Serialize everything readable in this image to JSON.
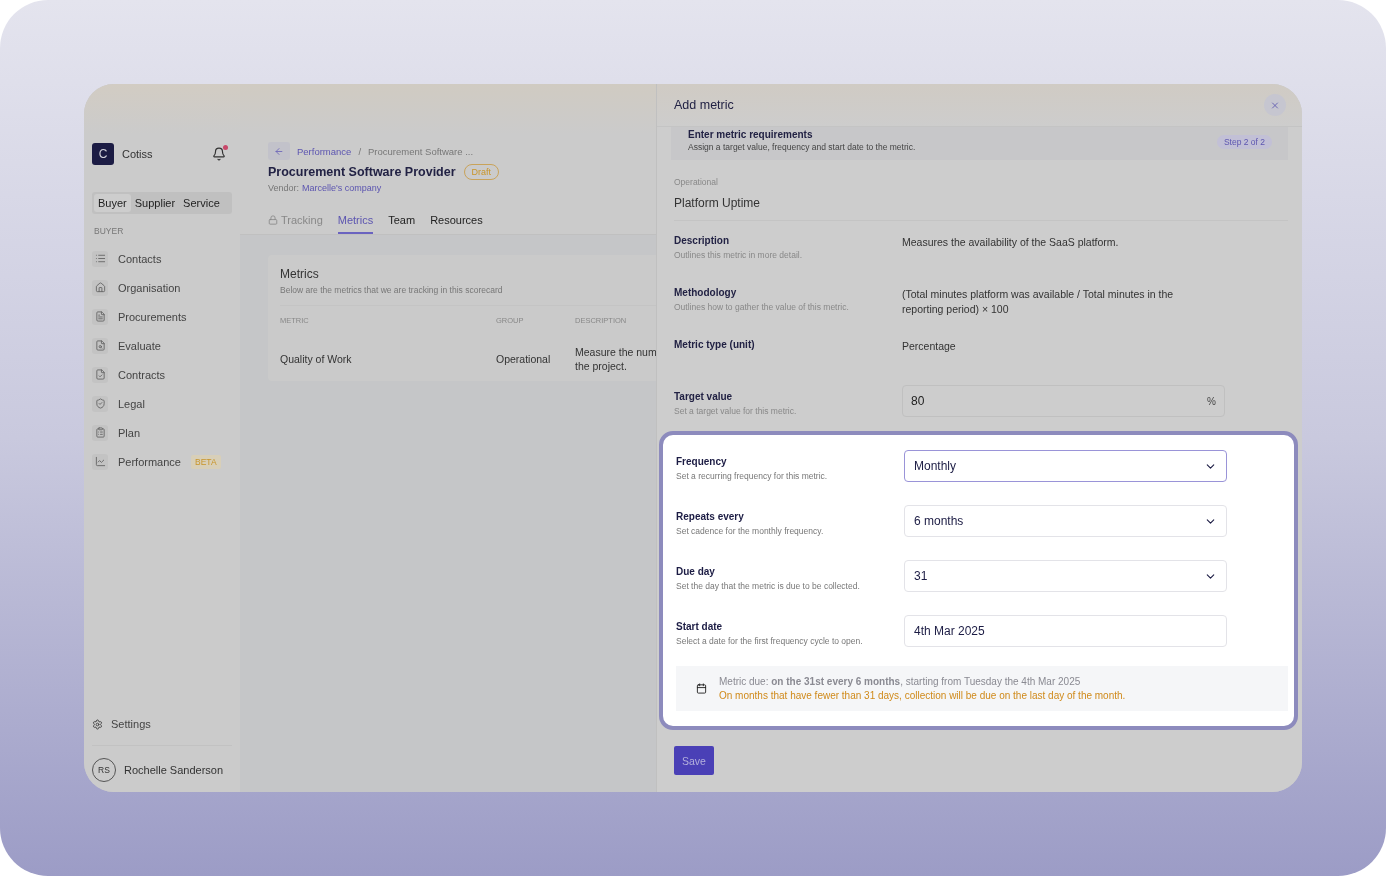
{
  "sidebar": {
    "brand": {
      "initial": "C",
      "name": "Cotiss"
    },
    "has_notification": true,
    "role_tabs": [
      {
        "label": "Buyer",
        "selected": true
      },
      {
        "label": "Supplier",
        "selected": false
      },
      {
        "label": "Service",
        "selected": false
      }
    ],
    "section": "BUYER",
    "items": [
      {
        "label": "Contacts"
      },
      {
        "label": "Organisation"
      },
      {
        "label": "Procurements"
      },
      {
        "label": "Evaluate"
      },
      {
        "label": "Contracts"
      },
      {
        "label": "Legal"
      },
      {
        "label": "Plan"
      },
      {
        "label": "Performance",
        "badge": "BETA"
      }
    ],
    "settings": "Settings",
    "user": {
      "initials": "RS",
      "name": "Rochelle Sanderson"
    }
  },
  "main": {
    "breadcrumb": [
      "Performance",
      "/",
      "Procurement Software ..."
    ],
    "title": "Procurement Software Provider",
    "status": "Draft",
    "vendor_label": "Vendor:",
    "vendor": "Marcelle's company",
    "tabs": [
      {
        "label": "Tracking",
        "selected": false,
        "locked": true
      },
      {
        "label": "Metrics",
        "selected": true,
        "locked": false
      },
      {
        "label": "Team",
        "selected": false,
        "locked": false
      },
      {
        "label": "Resources",
        "selected": false,
        "locked": false
      }
    ],
    "card": {
      "title": "Metrics",
      "subtitle": "Below are the metrics that we are tracking in this scorecard",
      "columns": [
        "METRIC",
        "GROUP",
        "DESCRIPTION"
      ],
      "rows": [
        [
          "Quality of Work",
          "Operational",
          "Measure the num\nthe project."
        ]
      ]
    }
  },
  "drawer": {
    "title": "Add metric",
    "step": {
      "title": "Enter metric requirements",
      "subtitle": "Assign a target value, frequency and start date to the metric.",
      "badge": "Step 2 of 2"
    },
    "group": "Operational",
    "metric": "Platform Uptime",
    "info": [
      {
        "label": "Description",
        "hint": "Outlines this metric in more detail.",
        "value": "Measures the availability of the SaaS platform."
      },
      {
        "label": "Methodology",
        "hint": "Outlines how to gather the value of this metric.",
        "value": "(Total minutes platform was available / Total minutes in the reporting period) × 100"
      },
      {
        "label": "Metric type (unit)",
        "value": "Percentage"
      }
    ],
    "target": {
      "label": "Target value",
      "hint": "Set a target value for this metric.",
      "value": "80",
      "suffix": "%"
    },
    "fields": [
      {
        "kind": "select",
        "label": "Frequency",
        "hint": "Set a recurring frequency for this metric.",
        "value": "Monthly",
        "focused": true
      },
      {
        "kind": "select",
        "label": "Repeats every",
        "hint": "Set cadence for the monthly frequency.",
        "value": "6 months",
        "focused": false
      },
      {
        "kind": "select",
        "label": "Due day",
        "hint": "Set the day that the metric is due to be collected.",
        "value": "31",
        "focused": false
      },
      {
        "kind": "date",
        "label": "Start date",
        "hint": "Select a date for the first frequency cycle to open.",
        "value": "4th Mar 2025",
        "focused": false
      }
    ],
    "summary": {
      "text": "Metric due: **on the 31st every 6 months**, starting from Tuesday the 4th Mar 2025",
      "warning": "On months that have fewer than 31 days, collection will be due on the last day of the month."
    },
    "save": "Save"
  }
}
